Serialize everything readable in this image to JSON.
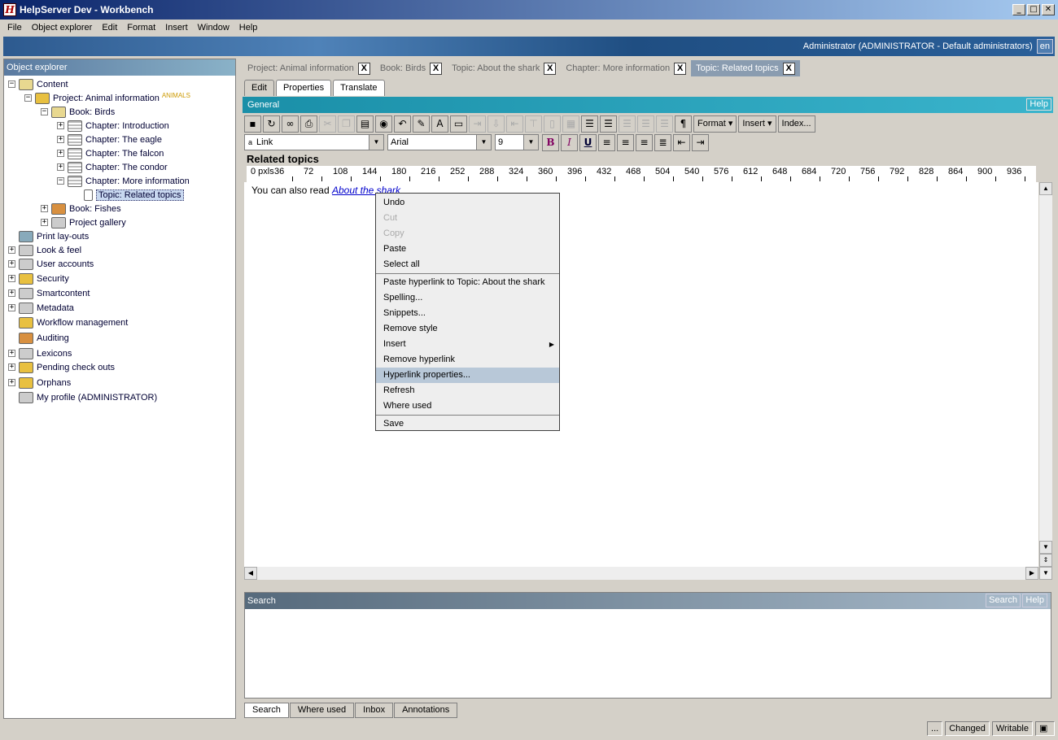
{
  "window": {
    "title": "HelpServer Dev - Workbench",
    "icon_letter": "H"
  },
  "menubar": [
    "File",
    "Object explorer",
    "Edit",
    "Format",
    "Insert",
    "Window",
    "Help"
  ],
  "banner": {
    "user": "Administrator (ADMINISTRATOR - Default administrators)",
    "lang": "en"
  },
  "object_explorer": {
    "title": "Object explorer",
    "items": [
      {
        "label": "Content",
        "icon": "folder-icon",
        "expander": "minus"
      },
      {
        "label": "Project: Animal information",
        "icon": "project-icon",
        "expander": "minus",
        "tag": "ANIMALS"
      },
      {
        "label": "Book: Birds",
        "icon": "book-open-icon",
        "expander": "minus"
      },
      {
        "label": "Chapter: Introduction",
        "icon": "chapter-icon",
        "expander": "plus"
      },
      {
        "label": "Chapter: The eagle",
        "icon": "chapter-icon",
        "expander": "plus"
      },
      {
        "label": "Chapter: The falcon",
        "icon": "chapter-icon",
        "expander": "plus"
      },
      {
        "label": "Chapter: The condor",
        "icon": "chapter-icon",
        "expander": "plus"
      },
      {
        "label": "Chapter: More information",
        "icon": "chapter-icon",
        "expander": "minus"
      },
      {
        "label": "Topic: Related topics",
        "icon": "topic-icon",
        "expander": ""
      },
      {
        "label": "Book: Fishes",
        "icon": "book-icon",
        "expander": "plus"
      },
      {
        "label": "Project gallery",
        "icon": "gallery-icon",
        "expander": "plus"
      },
      {
        "label": "Print lay-outs",
        "icon": "printer-icon",
        "expander": ""
      },
      {
        "label": "Look & feel",
        "icon": "monitor-icon",
        "expander": "plus"
      },
      {
        "label": "User accounts",
        "icon": "users-icon",
        "expander": "plus"
      },
      {
        "label": "Security",
        "icon": "lock-icon",
        "expander": "plus"
      },
      {
        "label": "Smartcontent",
        "icon": "smartcontent-icon",
        "expander": "plus"
      },
      {
        "label": "Metadata",
        "icon": "metadata-icon",
        "expander": "plus"
      },
      {
        "label": "Workflow management",
        "icon": "workflow-icon",
        "expander": ""
      },
      {
        "label": "Auditing",
        "icon": "chart-icon",
        "expander": ""
      },
      {
        "label": "Lexicons",
        "icon": "lexicon-icon",
        "expander": "plus"
      },
      {
        "label": "Pending check outs",
        "icon": "checkout-icon",
        "expander": "plus"
      },
      {
        "label": "Orphans",
        "icon": "orphans-icon",
        "expander": "plus"
      },
      {
        "label": "My profile (ADMINISTRATOR)",
        "icon": "profile-icon",
        "expander": ""
      }
    ]
  },
  "doc_tabs": [
    {
      "label": "Project: Animal information",
      "close": "X"
    },
    {
      "label": "Book: Birds",
      "close": "X"
    },
    {
      "label": "Topic: About the shark",
      "close": "X"
    },
    {
      "label": "Chapter: More information",
      "close": "X"
    },
    {
      "label": "Topic: Related topics",
      "close": "X",
      "active": true
    }
  ],
  "edit_tabs": [
    "Edit",
    "Properties",
    "Translate"
  ],
  "general": {
    "label": "General",
    "help": "Help"
  },
  "toolbar": {
    "format": "Format",
    "insert": "Insert",
    "index": "Index...",
    "style": "Link",
    "font": "Arial",
    "size": "9",
    "bold": "B",
    "italic": "I",
    "underline": "U",
    "pilcrow": "¶"
  },
  "document": {
    "title": "Related topics",
    "text_prefix": "You can also read ",
    "link": "About the shark"
  },
  "ruler": {
    "unit": "0 pxls",
    "ticks": [
      "36",
      "72",
      "108",
      "144",
      "180",
      "216",
      "252",
      "288",
      "324",
      "360",
      "396",
      "432",
      "468",
      "504",
      "540",
      "576",
      "612",
      "648",
      "684",
      "720",
      "756",
      "792",
      "828",
      "864",
      "900",
      "936"
    ]
  },
  "context_menu": {
    "group1": [
      {
        "label": "Undo"
      },
      {
        "label": "Cut",
        "disabled": true
      },
      {
        "label": "Copy",
        "disabled": true
      },
      {
        "label": "Paste"
      },
      {
        "label": "Select all"
      }
    ],
    "group2": [
      {
        "label": "Paste hyperlink to Topic: About the shark"
      },
      {
        "label": "Spelling..."
      },
      {
        "label": "Snippets..."
      },
      {
        "label": "Remove style"
      },
      {
        "label": "Insert",
        "submenu": true
      },
      {
        "label": "Remove hyperlink"
      },
      {
        "label": "Hyperlink properties...",
        "highlighted": true
      },
      {
        "label": "Refresh"
      },
      {
        "label": "Where used"
      }
    ],
    "group3": [
      {
        "label": "Save"
      }
    ]
  },
  "search_panel": {
    "title": "Search",
    "search_btn": "Search",
    "help_btn": "Help"
  },
  "bottom_tabs": [
    "Search",
    "Where used",
    "Inbox",
    "Annotations"
  ],
  "status": {
    "ellipsis": "...",
    "changed": "Changed",
    "writable": "Writable"
  }
}
